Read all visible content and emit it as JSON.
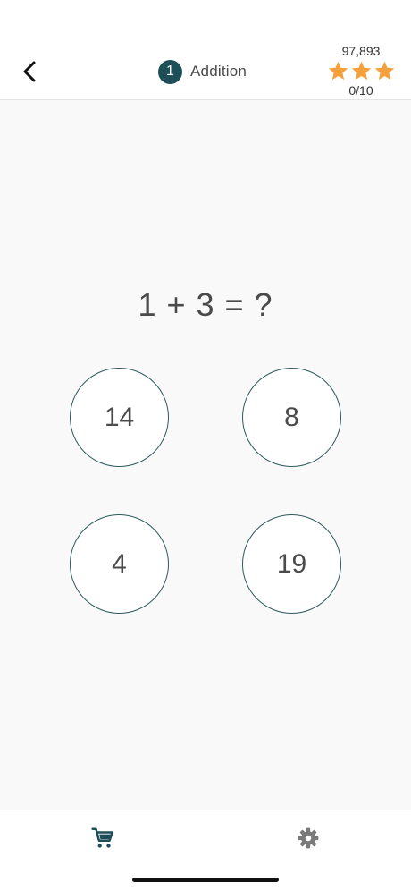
{
  "header": {
    "level_number": "1",
    "level_title": "Addition",
    "score_total": "97,893",
    "stars_count": 3,
    "progress": "0/10"
  },
  "quiz": {
    "question": "1 + 3 = ?",
    "answers": [
      "14",
      "8",
      "4",
      "19"
    ]
  },
  "bottom_nav": {
    "tabs": [
      "cart-icon",
      "gear-icon"
    ]
  },
  "colors": {
    "accent": "#1e4e58",
    "star": "#f5a03a",
    "answer_border": "#2d5a5a",
    "text": "#4a4a4a",
    "background": "#f9f9f9"
  }
}
